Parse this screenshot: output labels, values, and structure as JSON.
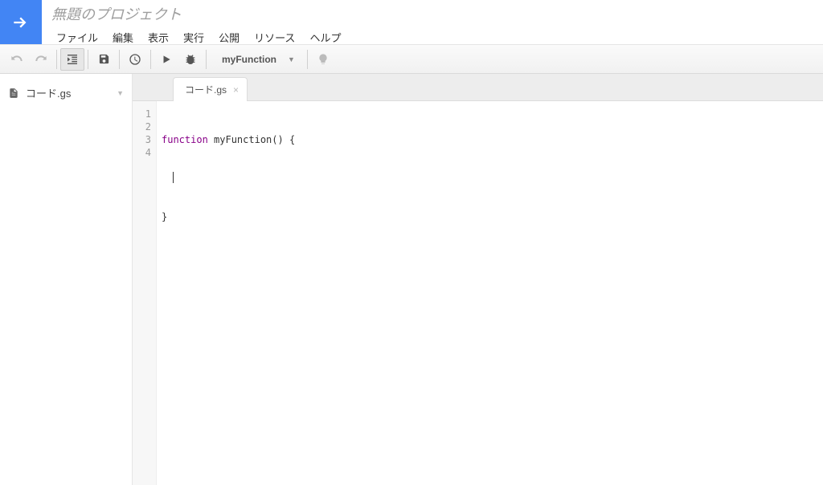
{
  "header": {
    "project_title": "無題のプロジェクト",
    "menu": [
      "ファイル",
      "編集",
      "表示",
      "実行",
      "公開",
      "リソース",
      "ヘルプ"
    ]
  },
  "toolbar": {
    "selected_function": "myFunction"
  },
  "sidebar": {
    "files": [
      {
        "name": "コード.gs"
      }
    ]
  },
  "tabs": [
    {
      "label": "コード.gs"
    }
  ],
  "editor": {
    "line_numbers": [
      "1",
      "2",
      "3",
      "4"
    ],
    "code": {
      "line1_kw": "function",
      "line1_rest": " myFunction() {",
      "line2_indent": "  ",
      "line3": "}",
      "line4": ""
    }
  }
}
